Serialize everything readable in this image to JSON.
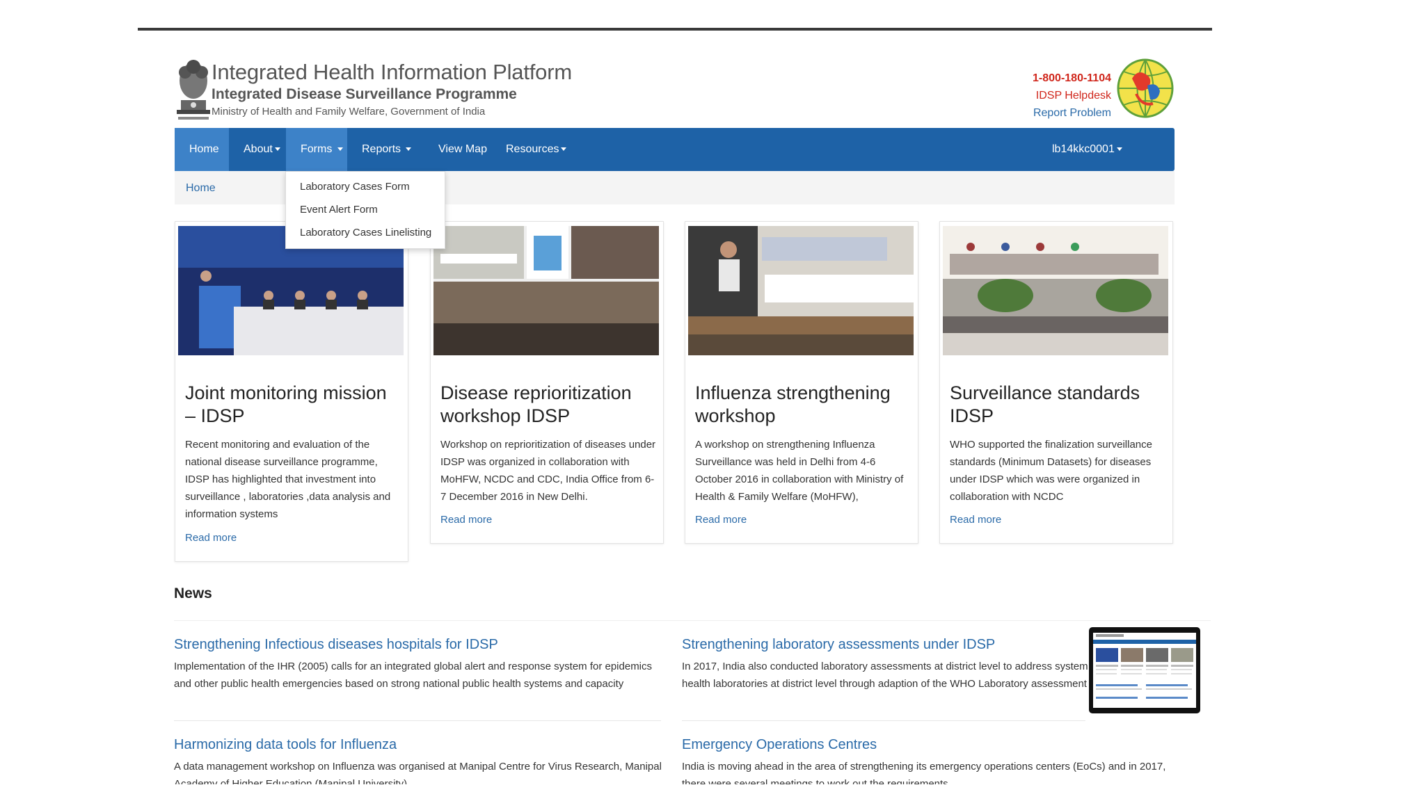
{
  "header": {
    "title": "Integrated Health Information Platform",
    "subtitle": "Integrated Disease Surveillance Programme",
    "ministry": "Ministry of Health and Family Welfare, Government of India",
    "phone": "1-800-180-1104",
    "helpdesk": "IDSP Helpdesk",
    "report_problem": "Report Problem"
  },
  "nav": {
    "home": "Home",
    "about": "About",
    "forms": "Forms",
    "reports": "Reports",
    "view_map": "View Map",
    "resources": "Resources",
    "user": "lb14kkc0001"
  },
  "forms_dropdown": [
    "Laboratory Cases Form",
    "Event Alert Form",
    "Laboratory Cases Linelisting"
  ],
  "breadcrumb": {
    "home": "Home"
  },
  "cards": [
    {
      "title": "Joint monitoring mission – IDSP",
      "description": "Recent monitoring and evaluation of the national disease surveillance programme, IDSP has highlighted that investment into surveillance , laboratories ,data analysis and information systems",
      "read_more": "Read more"
    },
    {
      "title": "Disease reprioritization workshop IDSP",
      "description": "Workshop on reprioritization of diseases under IDSP was organized in collaboration with MoHFW, NCDC and CDC, India Office from 6-7 December 2016 in New Delhi.",
      "read_more": "Read more"
    },
    {
      "title": "Influenza strengthening workshop",
      "description": "A workshop on strengthening Influenza Surveillance was held in Delhi from 4-6 October 2016 in collaboration with Ministry of Health & Family Welfare (MoHFW),",
      "read_more": "Read more"
    },
    {
      "title": "Surveillance standards IDSP",
      "description": "WHO supported the finalization surveillance standards (Minimum Datasets) for diseases under IDSP which was were organized in collaboration with NCDC",
      "read_more": "Read more"
    }
  ],
  "news": {
    "heading": "News",
    "items": [
      {
        "title": "Strengthening Infectious diseases hospitals for IDSP",
        "description": "Implementation of the IHR (2005) calls for an integrated global alert and response system for epidemics and other public health emergencies based on strong national public health systems and capacity"
      },
      {
        "title": "Strengthening laboratory assessments under IDSP",
        "description": "In 2017, India also conducted laboratory assessments at district level to address system health laboratories at district level through adaption of the WHO Laboratory assessment"
      },
      {
        "title": "Harmonizing data tools for Influenza",
        "description": "A data management workshop on Influenza was organised at Manipal Centre for Virus Research, Manipal Academy of Higher Education (Manipal University)"
      },
      {
        "title": "Emergency Operations Centres",
        "description": "India is moving ahead in the area of strengthening its emergency operations centers (EoCs) and in 2017, there were several meetings to work out the requirements"
      }
    ]
  },
  "colors": {
    "nav_bg": "#1e62a7",
    "nav_active": "#3d82c8",
    "link": "#2a6aa8",
    "helpline": "#d0261b"
  }
}
